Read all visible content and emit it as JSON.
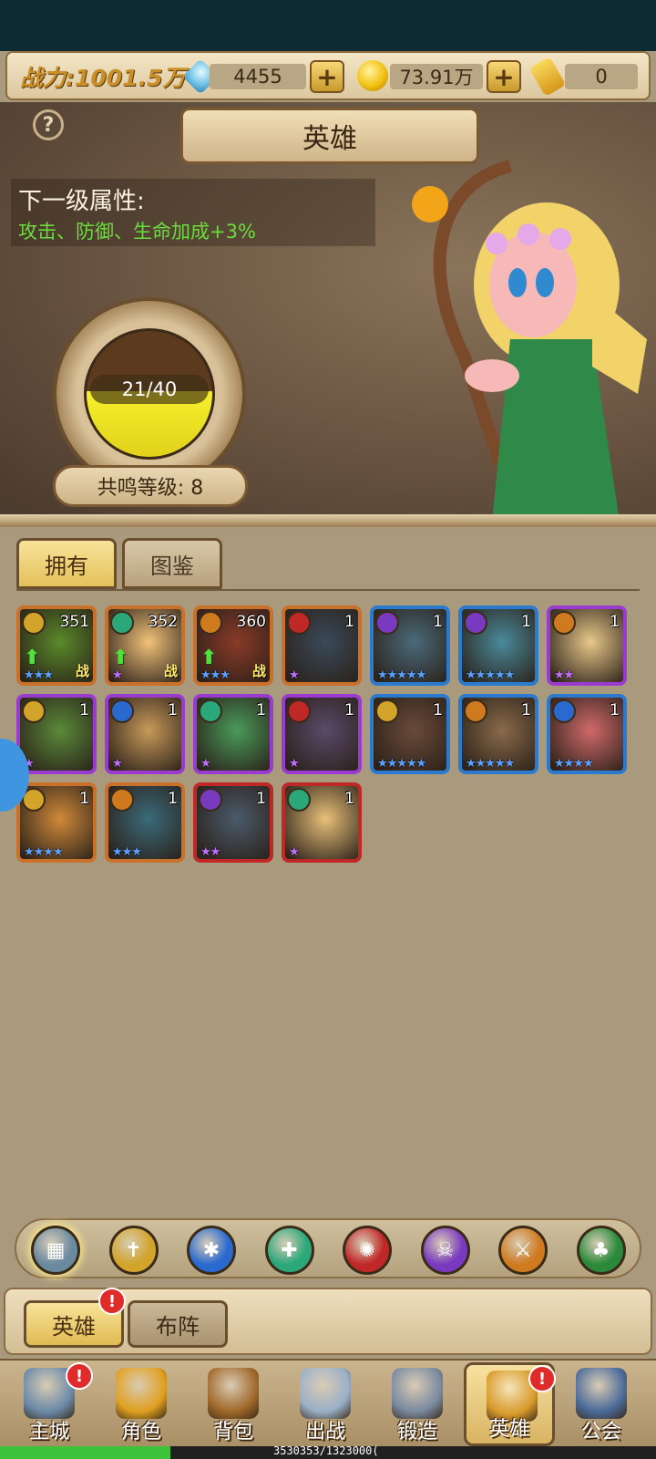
{
  "resources": {
    "power_label": "战力:1001.5万",
    "gems": "4455",
    "gold": "73.91万",
    "tickets": "0"
  },
  "header": {
    "title": "英雄",
    "help": "?"
  },
  "next_level": {
    "title": "下一级属性:",
    "desc": "攻击、防御、生命加成+3%"
  },
  "resonance": {
    "progress_text": "21/40",
    "progress_fraction": 0.525,
    "level_label": "共鸣等级: 8"
  },
  "tabs": {
    "owned": "拥有",
    "codex": "图鉴"
  },
  "heroes": [
    {
      "count": "351",
      "stars": 3,
      "tag": "战",
      "up": true,
      "border": "#c9702a",
      "bg": "#5a8a2a",
      "faction": "#d2a42a"
    },
    {
      "count": "352",
      "stars": 1,
      "tag": "战",
      "up": true,
      "border": "#c9702a",
      "bg": "#f2c27a",
      "faction": "#2aa87a"
    },
    {
      "count": "360",
      "stars": 3,
      "tag": "战",
      "up": true,
      "border": "#c9702a",
      "bg": "#8a3a28",
      "faction": "#d07a20"
    },
    {
      "count": "1",
      "stars": 1,
      "tag": "",
      "up": false,
      "border": "#c9702a",
      "bg": "#3a4a5a",
      "faction": "#c02828"
    },
    {
      "count": "1",
      "stars": 5,
      "tag": "",
      "up": false,
      "border": "#2a7ad0",
      "bg": "#4a6a7a",
      "faction": "#7a3ac0"
    },
    {
      "count": "1",
      "stars": 5,
      "tag": "",
      "up": false,
      "border": "#2a7ad0",
      "bg": "#4a8a9a",
      "faction": "#7a3ac0"
    },
    {
      "count": "1",
      "stars": 2,
      "tag": "",
      "up": false,
      "border": "#9a3ad0",
      "bg": "#e8c88a",
      "faction": "#d07a20"
    },
    {
      "count": "1",
      "stars": 1,
      "tag": "",
      "up": false,
      "border": "#9a3ad0",
      "bg": "#5a8a3a",
      "faction": "#d2a42a"
    },
    {
      "count": "1",
      "stars": 1,
      "tag": "",
      "up": false,
      "border": "#9a3ad0",
      "bg": "#c89a5a",
      "faction": "#2a6ad0"
    },
    {
      "count": "1",
      "stars": 1,
      "tag": "",
      "up": false,
      "border": "#9a3ad0",
      "bg": "#4a9a5a",
      "faction": "#2aa87a"
    },
    {
      "count": "1",
      "stars": 1,
      "tag": "",
      "up": false,
      "border": "#9a3ad0",
      "bg": "#5a4a6a",
      "faction": "#c02828"
    },
    {
      "count": "1",
      "stars": 5,
      "tag": "",
      "up": false,
      "border": "#2a7ad0",
      "bg": "#6a4a3a",
      "faction": "#d2a42a"
    },
    {
      "count": "1",
      "stars": 5,
      "tag": "",
      "up": false,
      "border": "#2a7ad0",
      "bg": "#8a6a4a",
      "faction": "#d07a20"
    },
    {
      "count": "1",
      "stars": 4,
      "tag": "",
      "up": false,
      "border": "#2a7ad0",
      "bg": "#d06a6a",
      "faction": "#2a6ad0"
    },
    {
      "count": "1",
      "stars": 4,
      "tag": "",
      "up": false,
      "border": "#c9702a",
      "bg": "#d08a3a",
      "faction": "#d2a42a"
    },
    {
      "count": "1",
      "stars": 3,
      "tag": "",
      "up": false,
      "border": "#c9702a",
      "bg": "#3a6a7a",
      "faction": "#d07a20"
    },
    {
      "count": "1",
      "stars": 2,
      "tag": "",
      "up": false,
      "border": "#c02828",
      "bg": "#4a5a6a",
      "faction": "#7a3ac0"
    },
    {
      "count": "1",
      "stars": 1,
      "tag": "",
      "up": false,
      "border": "#c02828",
      "bg": "#e8c07a",
      "faction": "#2aa87a"
    }
  ],
  "filters": [
    {
      "name": "all",
      "color": "#6a8aa0"
    },
    {
      "name": "gold",
      "color": "#d2a42a"
    },
    {
      "name": "blue",
      "color": "#2a6ad0"
    },
    {
      "name": "teal",
      "color": "#2aa87a"
    },
    {
      "name": "red",
      "color": "#c02828"
    },
    {
      "name": "purple",
      "color": "#7a3ac0"
    },
    {
      "name": "orange",
      "color": "#d07a20"
    },
    {
      "name": "green",
      "color": "#2a8a3a"
    }
  ],
  "subtabs": {
    "heroes": "英雄",
    "formation": "布阵",
    "badge": "!"
  },
  "nav": [
    {
      "label": "主城",
      "icon": "castle-icon",
      "color": "#6a8aa8",
      "badge": true,
      "active": false
    },
    {
      "label": "角色",
      "icon": "crown-icon",
      "color": "#e0a020",
      "badge": false,
      "active": false
    },
    {
      "label": "背包",
      "icon": "backpack-icon",
      "color": "#a0682a",
      "badge": false,
      "active": false
    },
    {
      "label": "出战",
      "icon": "swords-icon",
      "color": "#9ab0c8",
      "badge": false,
      "active": false
    },
    {
      "label": "锻造",
      "icon": "hammer-icon",
      "color": "#7a8aa0",
      "badge": false,
      "active": false
    },
    {
      "label": "英雄",
      "icon": "hero-shield-icon",
      "color": "#d89a2a",
      "badge": true,
      "active": true
    },
    {
      "label": "公会",
      "icon": "guild-shield-icon",
      "color": "#4a6a9a",
      "badge": false,
      "active": false
    }
  ],
  "exp": {
    "text": "3530353/1323000(",
    "fraction": 0.26
  }
}
